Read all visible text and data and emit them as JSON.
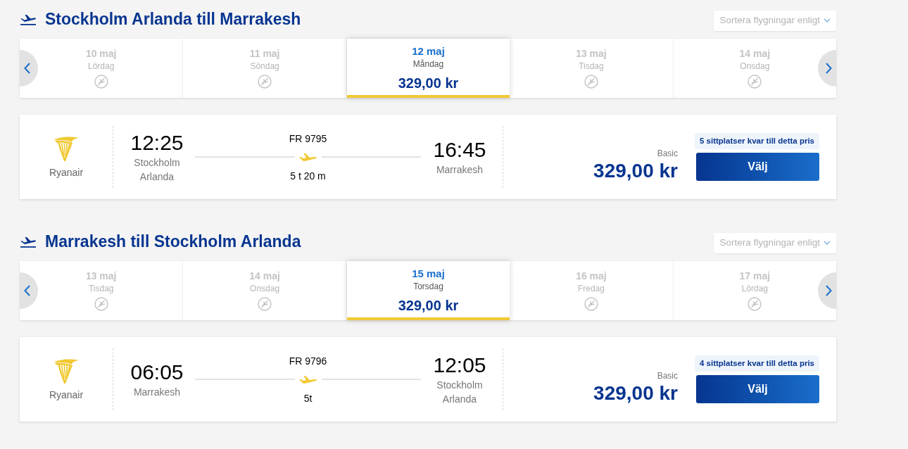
{
  "sections": [
    {
      "title": "Stockholm Arlanda till Marrakesh",
      "sort": {
        "label": "Sortera flygningar enligt"
      },
      "dates": [
        {
          "date": "10 maj",
          "weekday": "Lördag",
          "selected": false
        },
        {
          "date": "11 maj",
          "weekday": "Söndag",
          "selected": false
        },
        {
          "date": "12 maj",
          "weekday": "Måndag",
          "price": "329,00 kr",
          "selected": true
        },
        {
          "date": "13 maj",
          "weekday": "Tisdag",
          "selected": false
        },
        {
          "date": "14 maj",
          "weekday": "Onsdag",
          "selected": false
        }
      ],
      "flights": [
        {
          "airline": "Ryanair",
          "departure": {
            "time": "12:25",
            "airport": "Stockholm Arlanda"
          },
          "flight_number": "FR 9795",
          "duration": "5 t 20 m",
          "arrival": {
            "time": "16:45",
            "airport": "Marrakesh"
          },
          "fare": "Basic",
          "price": "329,00 kr",
          "seats_left": "5 sittplatser kvar till detta pris",
          "button": "Välj"
        }
      ]
    },
    {
      "title": "Marrakesh till Stockholm Arlanda",
      "sort": {
        "label": "Sortera flygningar enligt"
      },
      "dates": [
        {
          "date": "13 maj",
          "weekday": "Tisdag",
          "selected": false
        },
        {
          "date": "14 maj",
          "weekday": "Onsdag",
          "selected": false
        },
        {
          "date": "15 maj",
          "weekday": "Torsdag",
          "price": "329,00 kr",
          "selected": true
        },
        {
          "date": "16 maj",
          "weekday": "Fredag",
          "selected": false
        },
        {
          "date": "17 maj",
          "weekday": "Lördag",
          "selected": false
        }
      ],
      "flights": [
        {
          "airline": "Ryanair",
          "departure": {
            "time": "06:05",
            "airport": "Marrakesh"
          },
          "flight_number": "FR 9796",
          "duration": "5t",
          "arrival": {
            "time": "12:05",
            "airport": "Stockholm Arlanda"
          },
          "fare": "Basic",
          "price": "329,00 kr",
          "seats_left": "4 sittplatser kvar till detta pris",
          "button": "Välj"
        }
      ]
    }
  ]
}
